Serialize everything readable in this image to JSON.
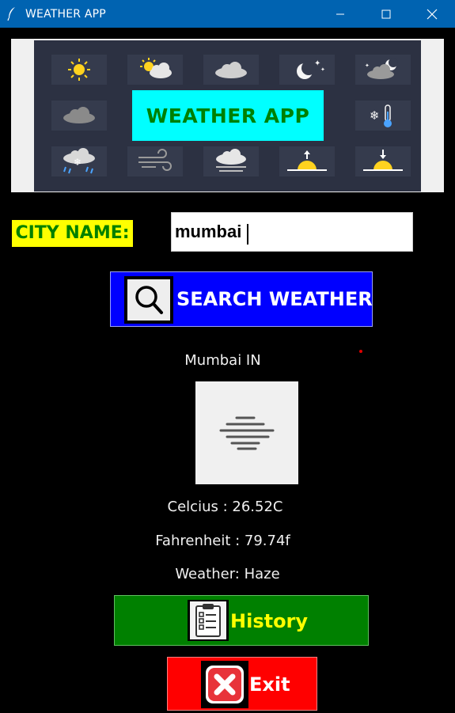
{
  "window": {
    "title": "WEATHER APP",
    "icon": "feather-icon",
    "controls": [
      "minimize-icon",
      "maximize-icon",
      "close-icon"
    ]
  },
  "banner": {
    "title": "WEATHER APP",
    "title_color": "#008000",
    "title_bg": "#00ffff",
    "icons": [
      "sun-icon",
      "partly-sunny-icon",
      "cloud-icon",
      "moon-stars-icon",
      "night-cloud-icon",
      "cloud-icon",
      "snow-thermometer-icon",
      "snow-rain-icon",
      "wind-icon",
      "fog-icon",
      "sunrise-icon",
      "sunset-icon"
    ]
  },
  "search": {
    "label": "CITY NAME:",
    "value": "mumbai",
    "button_label": "SEARCH WEATHER",
    "button_icon": "magnifier-icon"
  },
  "result": {
    "location": "Mumbai IN",
    "icon": "haze-icon",
    "celsius": "Celcius : 26.52C",
    "fahrenheit": "Fahrenheit : 79.74f",
    "weather": "Weather: Haze"
  },
  "actions": {
    "history_label": "History",
    "history_icon": "clipboard-icon",
    "exit_label": "Exit",
    "exit_icon": "close-x-icon"
  },
  "colors": {
    "background": "#000000",
    "titlebar": "#0063b1",
    "label_bg": "#ffff00",
    "search_btn": "#0000ff",
    "history_btn": "#008000",
    "exit_btn": "#ff0000"
  }
}
